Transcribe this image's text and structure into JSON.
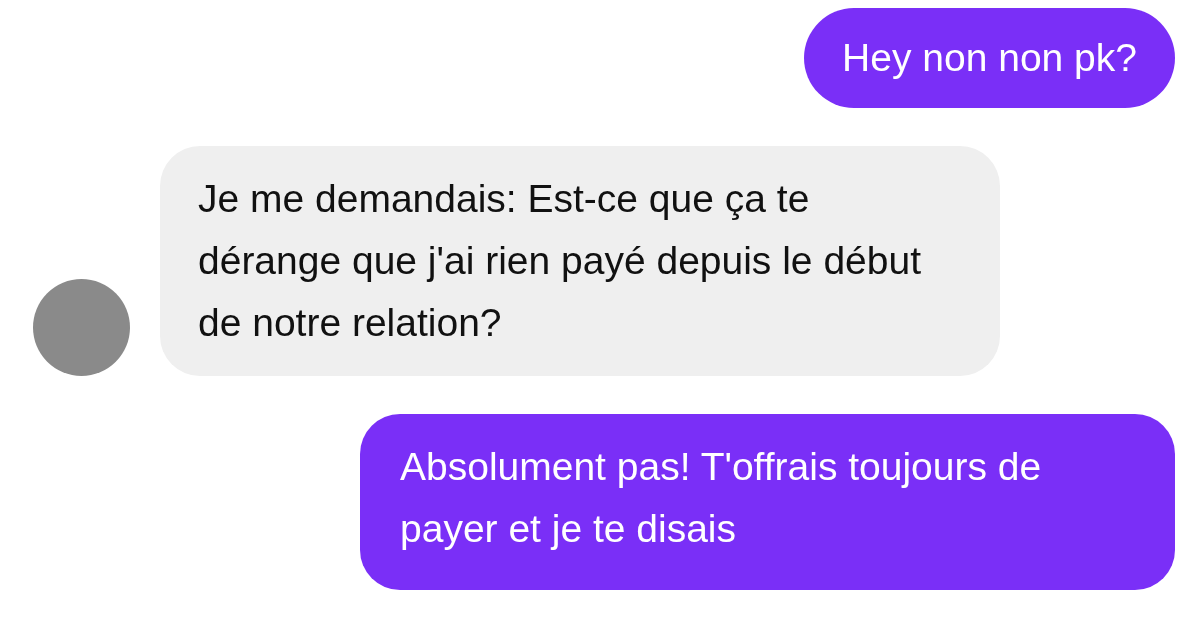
{
  "messages": [
    {
      "kind": "sent",
      "text": "Hey non non pk?"
    },
    {
      "kind": "received",
      "text": "Je me demandais: Est-ce que ça te dérange que j'ai rien payé depuis le début de notre relation?"
    },
    {
      "kind": "sent",
      "text": "Absolument pas! T'offrais toujours de payer et je te disais"
    }
  ]
}
